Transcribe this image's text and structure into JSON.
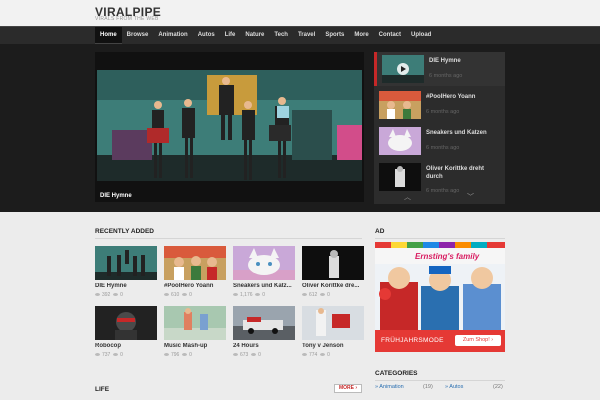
{
  "site": {
    "logo": "VIRALPIPE",
    "tagline": "VIRALS FROM THE WEB"
  },
  "nav": [
    "Home",
    "Browse",
    "Animation",
    "Autos",
    "Life",
    "Nature",
    "Tech",
    "Travel",
    "Sports",
    "More",
    "Contact",
    "Upload"
  ],
  "featured": {
    "caption": "DIE Hymne"
  },
  "playlist": [
    {
      "title": "DIE Hymne",
      "meta": "6 months ago"
    },
    {
      "title": "#PoolHero Yoann",
      "meta": "6 months ago"
    },
    {
      "title": "Sneakers und Katzen",
      "meta": "6 months ago"
    },
    {
      "title": "Oliver Korittke dreht durch",
      "meta": "6 months ago"
    }
  ],
  "recent": {
    "heading": "RECENTLY ADDED",
    "items": [
      {
        "title": "DIE Hymne",
        "views": "392",
        "likes": "0"
      },
      {
        "title": "#PoolHero Yoann",
        "views": "610",
        "likes": "0"
      },
      {
        "title": "Sneakers und Katz...",
        "views": "1,176",
        "likes": "0"
      },
      {
        "title": "Oliver Korittke dre...",
        "views": "612",
        "likes": "0"
      },
      {
        "title": "Robocop",
        "views": "737",
        "likes": "0"
      },
      {
        "title": "Music Mash-up",
        "views": "796",
        "likes": "0"
      },
      {
        "title": "24 Hours",
        "views": "673",
        "likes": "0"
      },
      {
        "title": "Tony v Jenson",
        "views": "774",
        "likes": "0"
      }
    ]
  },
  "life": {
    "heading": "LIFE",
    "more": "MORE ›"
  },
  "ad": {
    "heading": "AD",
    "brand": "Ernsting's family",
    "footer": "FRÜHJAHRSMODE",
    "cta": "Zum Shop! ›"
  },
  "categories": {
    "heading": "CATEGORIES",
    "items": [
      {
        "label": "» Animation",
        "count": "(19)"
      },
      {
        "label": "» Autos",
        "count": "(22)"
      }
    ]
  }
}
